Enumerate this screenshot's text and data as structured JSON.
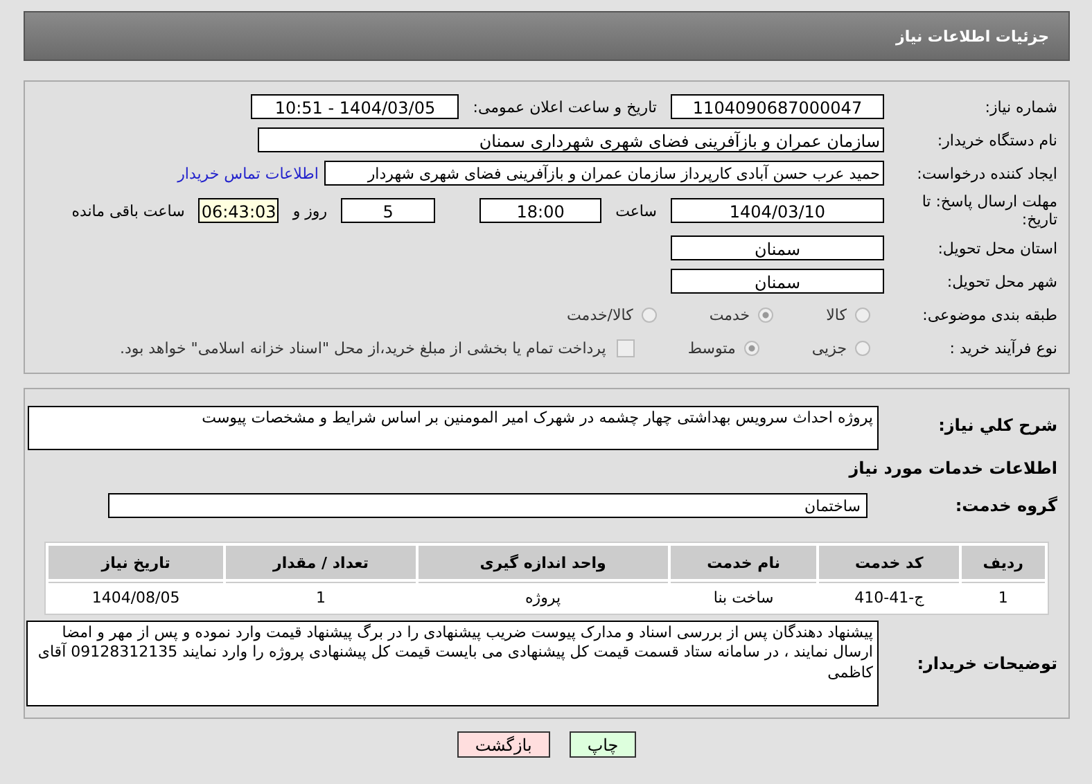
{
  "header": {
    "title": "جزئیات اطلاعات نیاز"
  },
  "fields": {
    "need_number": {
      "label": "شماره نیاز:",
      "value": "1104090687000047"
    },
    "announce": {
      "label": "تاریخ و ساعت اعلان عمومی:",
      "value": "1404/03/05 - 10:51"
    },
    "buyer_org": {
      "label": "نام دستگاه خریدار:",
      "value": "سازمان عمران و بازآفرینی فضای شهری شهرداری سمنان"
    },
    "requester": {
      "label": "ایجاد کننده درخواست:",
      "value": "حمید عرب حسن آبادی کارپرداز سازمان عمران و بازآفرینی فضای شهری شهردار",
      "link": "اطلاعات تماس خریدار"
    },
    "deadline": {
      "label": "مهلت ارسال پاسخ: تا تاریخ:",
      "date": "1404/03/10",
      "time_label": "ساعت",
      "time": "18:00",
      "days": "5",
      "days_label": "روز و",
      "remaining": "06:43:03",
      "remaining_label": "ساعت باقی مانده"
    },
    "province": {
      "label": "استان محل تحویل:",
      "value": "سمنان"
    },
    "city": {
      "label": "شهر محل تحویل:",
      "value": "سمنان"
    },
    "category": {
      "label": "طبقه بندی موضوعی:",
      "options": [
        {
          "label": "کالا",
          "selected": false
        },
        {
          "label": "خدمت",
          "selected": true
        },
        {
          "label": "کالا/خدمت",
          "selected": false
        }
      ]
    },
    "process": {
      "label": "نوع فرآیند خرید :",
      "options": [
        {
          "label": "جزیی",
          "selected": false
        },
        {
          "label": "متوسط",
          "selected": true
        }
      ],
      "payment": {
        "label": "پرداخت تمام یا بخشی از مبلغ خرید،از محل \"اسناد خزانه اسلامی\" خواهد بود.",
        "checked": false
      }
    }
  },
  "description": {
    "label": "شرح کلي نياز:",
    "value": "پروژه احداث سرویس بهداشتی چهار چشمه در شهرک امیر المومنین بر اساس شرایط و مشخصات پیوست"
  },
  "services": {
    "title": "اطلاعات خدمات مورد نیاز",
    "group_label": "گروه خدمت:",
    "group": "ساختمان",
    "columns": [
      "ردیف",
      "کد خدمت",
      "نام خدمت",
      "واحد اندازه گیری",
      "تعداد / مقدار",
      "تاریخ نیاز"
    ],
    "rows": [
      [
        "1",
        "ج-41-410",
        "ساخت بنا",
        "پروژه",
        "1",
        "1404/08/05"
      ]
    ]
  },
  "notes": {
    "label": "توضیحات خریدار:",
    "value": "پیشنهاد دهندگان پس از بررسی اسناد و مدارک پیوست ضریب  پیشنهادی را در برگ پیشنهاد قیمت وارد نموده و پس از مهر و امضا ارسال نمایند ، در سامانه ستاد قسمت قیمت کل پیشنهادی می بایست قیمت کل پیشنهادی پروژه را وارد نمایند 09128312135 آقای کاظمی"
  },
  "buttons": [
    {
      "label": "چاپ",
      "kind": "print"
    },
    {
      "label": "بازگشت",
      "kind": "back"
    }
  ]
}
